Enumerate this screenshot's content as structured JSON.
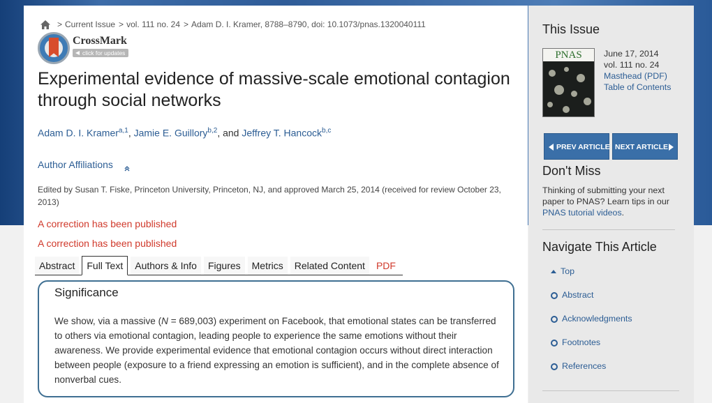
{
  "breadcrumb": {
    "items": [
      "Current Issue",
      "vol. 111 no. 24",
      "Adam D. I. Kramer,  8788–8790, doi: 10.1073/pnas.1320040111"
    ]
  },
  "crossmark": {
    "title": "CrossMark",
    "subtitle": "click for updates"
  },
  "article": {
    "title": "Experimental evidence of massive-scale emotional contagion through social networks",
    "authors": [
      {
        "name": "Adam D. I. Kramer",
        "sup": "a,1"
      },
      {
        "name": "Jamie E. Guillory",
        "sup": "b,2"
      },
      {
        "name": "Jeffrey T. Hancock",
        "sup": "b,c"
      }
    ],
    "author_sep1": ", ",
    "author_sep2": ", and ",
    "affiliations_label": "Author Affiliations",
    "edited_by": "Edited by Susan T. Fiske, Princeton University, Princeton, NJ, and approved March 25, 2014 (received for review October 23, 2013)",
    "corrections": [
      "A correction has been published",
      "A correction has been published"
    ]
  },
  "tabs": [
    "Abstract",
    "Full Text",
    "Authors & Info",
    "Figures",
    "Metrics",
    "Related Content",
    "PDF"
  ],
  "active_tab": "Full Text",
  "significance": {
    "title": "Significance",
    "body_before": "We show, via a massive (",
    "body_n": "N",
    "body_after": " = 689,003) experiment on Facebook, that emotional states can be transferred to others via emotional contagion, leading people to experience the same emotions without their awareness. We provide experimental evidence that emotional contagion occurs without direct interaction between people (exposure to a friend expressing an emotion is sufficient), and in the complete absence of nonverbal cues."
  },
  "sidebar": {
    "this_issue_heading": "This Issue",
    "cover_logo": "PNAS",
    "issue_date": "June 17, 2014",
    "issue_vol": "vol. 111 no. 24",
    "masthead_link": "Masthead (PDF)",
    "toc_link": "Table of Contents",
    "prev_label": "PREV ARTICLE",
    "next_label": "NEXT ARTICLE",
    "dont_miss_heading": "Don't Miss",
    "dont_miss_text": "Thinking of submitting your next paper to PNAS? Learn tips in our ",
    "dont_miss_link": "PNAS tutorial videos",
    "dont_miss_end": ".",
    "navigate_heading": "Navigate This Article",
    "navigate_items": [
      "Top",
      "Abstract",
      "Acknowledgments",
      "Footnotes",
      "References"
    ]
  },
  "colors": {
    "link": "#2c5d94",
    "correction": "#d0392b",
    "nav_button": "#3a6fa8",
    "significance_border": "#3f6f92"
  },
  "icons": [
    "home-icon",
    "crossmark-icon",
    "chevron-up-icon",
    "triangle-left-icon",
    "triangle-right-icon",
    "ring-icon"
  ]
}
